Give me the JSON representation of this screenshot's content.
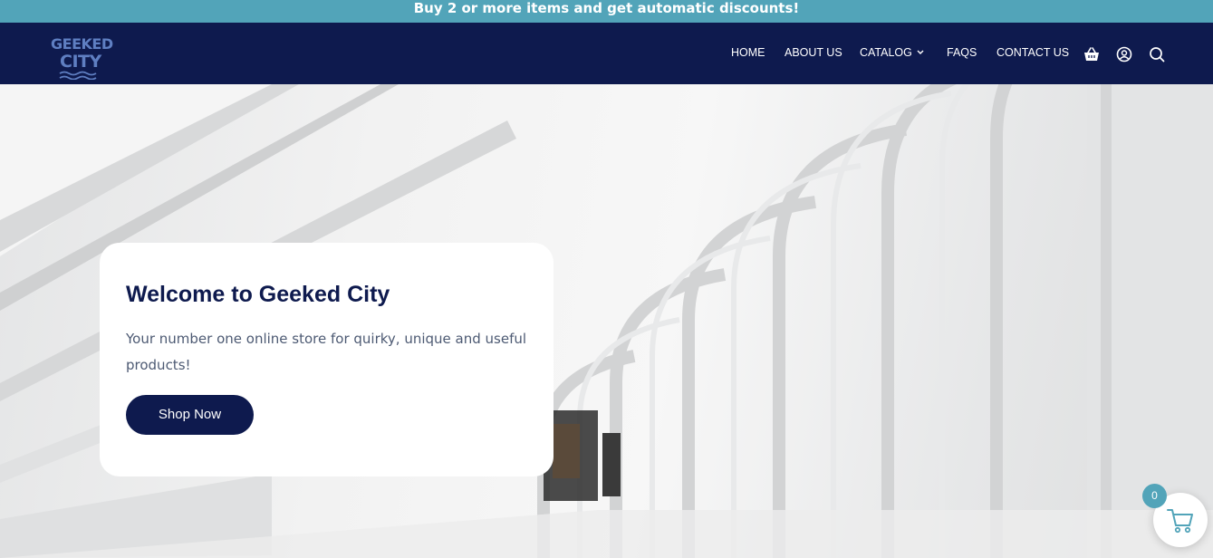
{
  "announcement": "Buy 2 or more items and get automatic discounts!",
  "logo": {
    "line1": "GEEKED",
    "line2": "CITY"
  },
  "nav": {
    "items": [
      {
        "label": "HOME"
      },
      {
        "label": "ABOUT US"
      },
      {
        "label": "CATALOG"
      },
      {
        "label": "FAQS"
      },
      {
        "label": "CONTACT US"
      }
    ],
    "icons": [
      "basket-icon",
      "account-icon",
      "search-icon"
    ]
  },
  "hero": {
    "title": "Welcome to Geeked City",
    "text": "Your number one online store for quirky, unique and useful products!",
    "button": "Shop Now"
  },
  "cart": {
    "count": "0"
  },
  "colors": {
    "announcement_bg": "#52a4b9",
    "header_bg": "#0e1a4e",
    "logo": "#5f7fc2",
    "button_bg": "#0e1a4e",
    "badge_bg": "#52a4b9"
  }
}
